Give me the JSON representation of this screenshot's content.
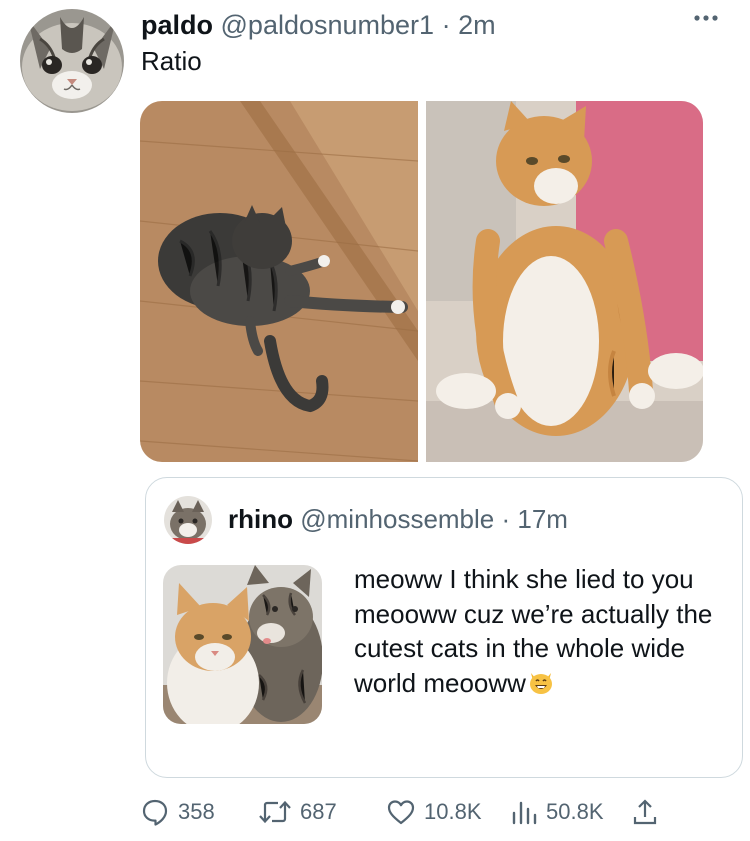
{
  "tweet": {
    "author": {
      "name": "paldo",
      "handle": "@paldosnumber1",
      "time": "· 2m"
    },
    "more_icon": "more-horizontal-icon",
    "text": "Ratio",
    "media": [
      {
        "name": "tabby-cat-on-floor-photo"
      },
      {
        "name": "orange-cat-standing-photo"
      }
    ],
    "quote": {
      "author": {
        "name": "rhino",
        "handle": "@minhossemble",
        "time": "· 17m"
      },
      "text": "meoww I think she lied to you meooww cuz we’re actually the cutest cats in the whole wide world meooww",
      "emoji": "grinning-cat-emoji"
    },
    "actions": {
      "replies": "358",
      "retweets": "687",
      "likes": "10.8K",
      "views": "50.8K"
    }
  },
  "colors": {
    "text_primary": "#0f1419",
    "text_secondary": "#536471",
    "border": "#cfd9de"
  }
}
